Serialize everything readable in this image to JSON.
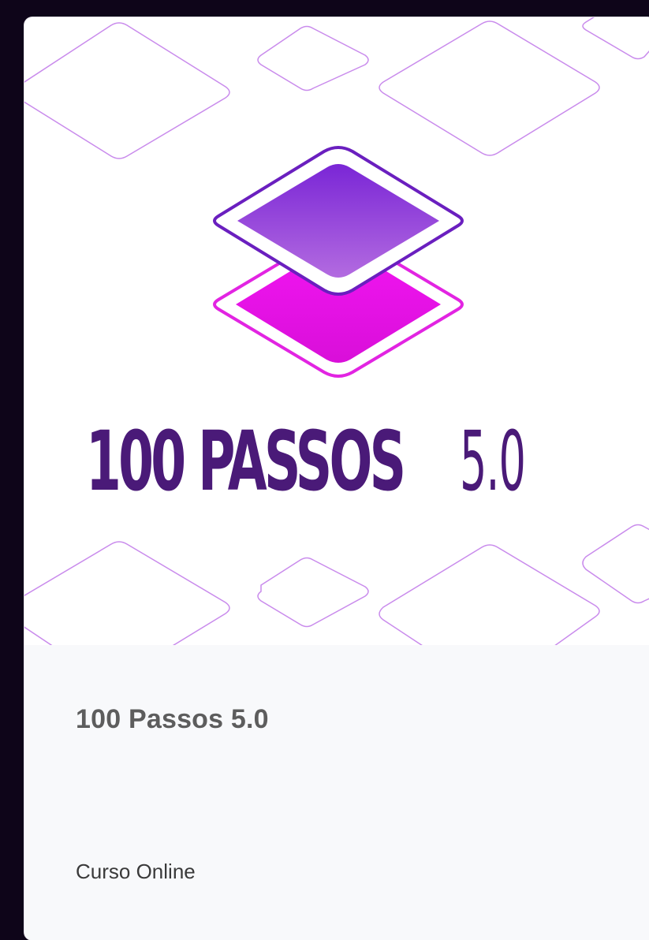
{
  "course": {
    "cover_logo_text": "100 PASSOS 5.0",
    "cover_logo_bold": "100 PASSOS",
    "cover_logo_light": "5.0",
    "title": "100 Passos 5.0",
    "type": "Curso Online"
  },
  "colors": {
    "page_background": "#0e0519",
    "logo_purple": "#4a1a78",
    "diamond_top": "#8a2ee0",
    "diamond_bottom": "#f010f0",
    "outline": "#c07ce8",
    "info_background": "#f8f9fb"
  },
  "icons": {
    "logo": "stacked-diamond-layers-icon"
  }
}
